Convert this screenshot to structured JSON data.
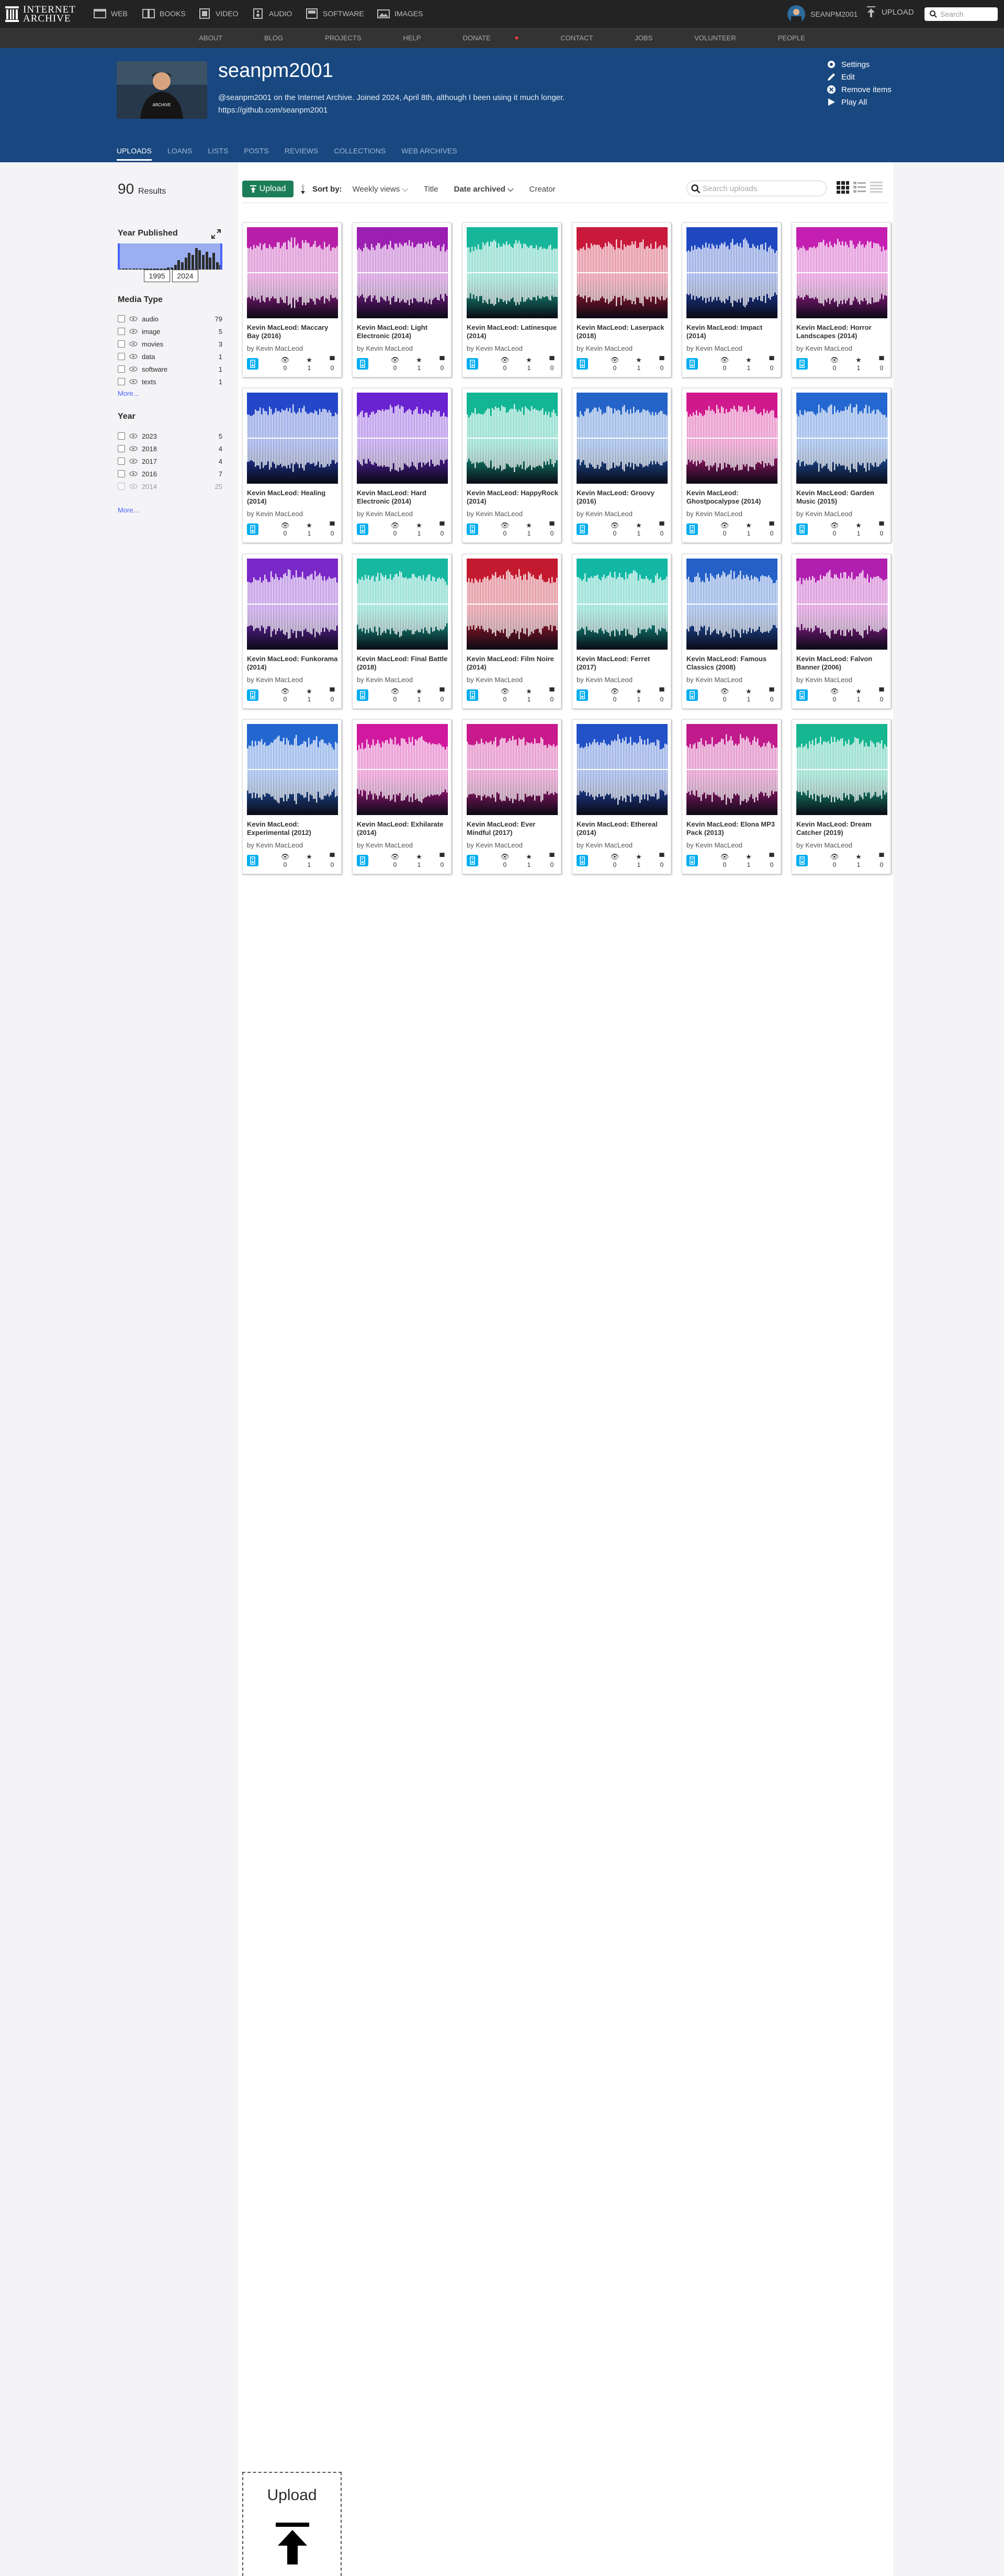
{
  "topnav": {
    "logo_line1": "INTERNET",
    "logo_line2": "ARCHIVE",
    "media": [
      {
        "label": "WEB",
        "icon": "web-icon"
      },
      {
        "label": "BOOKS",
        "icon": "books-icon"
      },
      {
        "label": "VIDEO",
        "icon": "video-icon"
      },
      {
        "label": "AUDIO",
        "icon": "audio-icon"
      },
      {
        "label": "SOFTWARE",
        "icon": "software-icon"
      },
      {
        "label": "IMAGES",
        "icon": "images-icon"
      }
    ],
    "username": "SEANPM2001",
    "upload_label": "UPLOAD",
    "search_placeholder": "Search"
  },
  "subnav": {
    "items": [
      "ABOUT",
      "BLOG",
      "PROJECTS",
      "HELP",
      "DONATE",
      "CONTACT",
      "JOBS",
      "VOLUNTEER",
      "PEOPLE"
    ],
    "donate_glyph": "♥"
  },
  "profile": {
    "name": "seanpm2001",
    "about": "@seanpm2001 on the Internet Archive. Joined 2024, April 8th, although I been using it much longer.",
    "link": "https://github.com/seanpm2001",
    "actions": [
      "Settings",
      "Edit",
      "Remove items",
      "Play All"
    ],
    "tabs": [
      "UPLOADS",
      "LOANS",
      "LISTS",
      "POSTS",
      "REVIEWS",
      "COLLECTIONS",
      "WEB ARCHIVES"
    ],
    "active_tab": "UPLOADS"
  },
  "sidebar": {
    "results_count": "90",
    "results_label": "Results",
    "year_published_title": "Year Published",
    "year_from": "1995",
    "year_to": "2024",
    "histogram": [
      0.05,
      0.05,
      0.05,
      0.05,
      0.05,
      0.05,
      0.05,
      0.05,
      0.05,
      0.05,
      0.05,
      0.05,
      0.05,
      0.05,
      0.08,
      0.08,
      0.2,
      0.4,
      0.3,
      0.5,
      0.7,
      0.6,
      0.9,
      0.8,
      0.6,
      0.75,
      0.5,
      0.7,
      0.3,
      0.2
    ],
    "media_type_title": "Media Type",
    "media_types": [
      {
        "label": "audio",
        "count": "79"
      },
      {
        "label": "image",
        "count": "5"
      },
      {
        "label": "movies",
        "count": "3"
      },
      {
        "label": "data",
        "count": "1"
      },
      {
        "label": "software",
        "count": "1"
      },
      {
        "label": "texts",
        "count": "1"
      }
    ],
    "more_label": "More...",
    "year_title": "Year",
    "years": [
      {
        "label": "2023",
        "count": "5"
      },
      {
        "label": "2018",
        "count": "4"
      },
      {
        "label": "2017",
        "count": "4"
      },
      {
        "label": "2016",
        "count": "7"
      },
      {
        "label": "2014",
        "count": "25"
      }
    ]
  },
  "toolbar": {
    "upload_label": "Upload",
    "sort_label": "Sort by:",
    "sort_options": [
      "Weekly views",
      "Title",
      "Date archived",
      "Creator"
    ],
    "selected_sort": "Date archived",
    "search_placeholder": "Search uploads"
  },
  "tiles": [
    {
      "title": "Kevin MacLeod: Maccary Bay (2016)",
      "by": "by Kevin MacLeod",
      "views": "0",
      "favs": "1",
      "reviews": "0",
      "color": "#b81fa8"
    },
    {
      "title": "Kevin MacLeod: Light Electronic (2014)",
      "by": "by Kevin MacLeod",
      "views": "0",
      "favs": "1",
      "reviews": "0",
      "color": "#9b1fb0"
    },
    {
      "title": "Kevin MacLeod: Latinesque (2014)",
      "by": "by Kevin MacLeod",
      "views": "0",
      "favs": "1",
      "reviews": "0",
      "color": "#17b69a"
    },
    {
      "title": "Kevin MacLeod: Laserpack (2018)",
      "by": "by Kevin MacLeod",
      "views": "0",
      "favs": "1",
      "reviews": "0",
      "color": "#c8193a"
    },
    {
      "title": "Kevin MacLeod: Impact (2014)",
      "by": "by Kevin MacLeod",
      "views": "0",
      "favs": "1",
      "reviews": "0",
      "color": "#1f48c0"
    },
    {
      "title": "Kevin MacLeod: Horror Landscapes (2014)",
      "by": "by Kevin MacLeod",
      "views": "0",
      "favs": "1",
      "reviews": "0",
      "color": "#c41fb0"
    },
    {
      "title": "Kevin MacLeod: Healing (2014)",
      "by": "by Kevin MacLeod",
      "views": "0",
      "favs": "1",
      "reviews": "0",
      "color": "#2446c8"
    },
    {
      "title": "Kevin MacLeod: Hard Electronic (2014)",
      "by": "by Kevin MacLeod",
      "views": "0",
      "favs": "1",
      "reviews": "0",
      "color": "#6a23d0"
    },
    {
      "title": "Kevin MacLeod: HappyRock (2014)",
      "by": "by Kevin MacLeod",
      "views": "0",
      "favs": "1",
      "reviews": "0",
      "color": "#12b594"
    },
    {
      "title": "Kevin MacLeod: Groovy (2016)",
      "by": "by Kevin MacLeod",
      "views": "0",
      "favs": "1",
      "reviews": "0",
      "color": "#2463c8"
    },
    {
      "title": "Kevin MacLeod: Ghostpocalypse (2014)",
      "by": "by Kevin MacLeod",
      "views": "0",
      "favs": "1",
      "reviews": "0",
      "color": "#d0198c"
    },
    {
      "title": "Kevin MacLeod: Garden Music (2015)",
      "by": "by Kevin MacLeod",
      "views": "0",
      "favs": "1",
      "reviews": "0",
      "color": "#2467d0"
    },
    {
      "title": "Kevin MacLeod: Funkorama (2014)",
      "by": "by Kevin MacLeod",
      "views": "0",
      "favs": "1",
      "reviews": "0",
      "color": "#7a28c8"
    },
    {
      "title": "Kevin MacLeod: Final Battle (2018)",
      "by": "by Kevin MacLeod",
      "views": "0",
      "favs": "1",
      "reviews": "0",
      "color": "#16b8a0"
    },
    {
      "title": "Kevin MacLeod: Film Noire (2014)",
      "by": "by Kevin MacLeod",
      "views": "0",
      "favs": "1",
      "reviews": "0",
      "color": "#c41a30"
    },
    {
      "title": "Kevin MacLeod: Ferret (2017)",
      "by": "by Kevin MacLeod",
      "views": "0",
      "favs": "1",
      "reviews": "0",
      "color": "#12b8a4"
    },
    {
      "title": "Kevin MacLeod: Famous Classics (2008)",
      "by": "by Kevin MacLeod",
      "views": "0",
      "favs": "1",
      "reviews": "0",
      "color": "#2460c8"
    },
    {
      "title": "Kevin MacLeod: Falvon Banner (2006)",
      "by": "by Kevin MacLeod",
      "views": "0",
      "favs": "1",
      "reviews": "0",
      "color": "#b01fb0"
    },
    {
      "title": "Kevin MacLeod: Experimental (2012)",
      "by": "by Kevin MacLeod",
      "views": "0",
      "favs": "1",
      "reviews": "0",
      "color": "#2466d0"
    },
    {
      "title": "Kevin MacLeod: Exhilarate (2014)",
      "by": "by Kevin MacLeod",
      "views": "0",
      "favs": "1",
      "reviews": "0",
      "color": "#d0199e"
    },
    {
      "title": "Kevin MacLeod: Ever Mindful (2017)",
      "by": "by Kevin MacLeod",
      "views": "0",
      "favs": "1",
      "reviews": "0",
      "color": "#c81a8c"
    },
    {
      "title": "Kevin MacLeod: Ethereal (2014)",
      "by": "by Kevin MacLeod",
      "views": "0",
      "favs": "1",
      "reviews": "0",
      "color": "#2352c8"
    },
    {
      "title": "Kevin MacLeod: Elona MP3 Pack (2013)",
      "by": "by Kevin MacLeod",
      "views": "0",
      "favs": "1",
      "reviews": "0",
      "color": "#c01a8c"
    },
    {
      "title": "Kevin MacLeod: Dream Catcher (2019)",
      "by": "by Kevin MacLeod",
      "views": "0",
      "favs": "1",
      "reviews": "0",
      "color": "#15b690"
    }
  ],
  "upload_zone": {
    "label": "Upload"
  }
}
